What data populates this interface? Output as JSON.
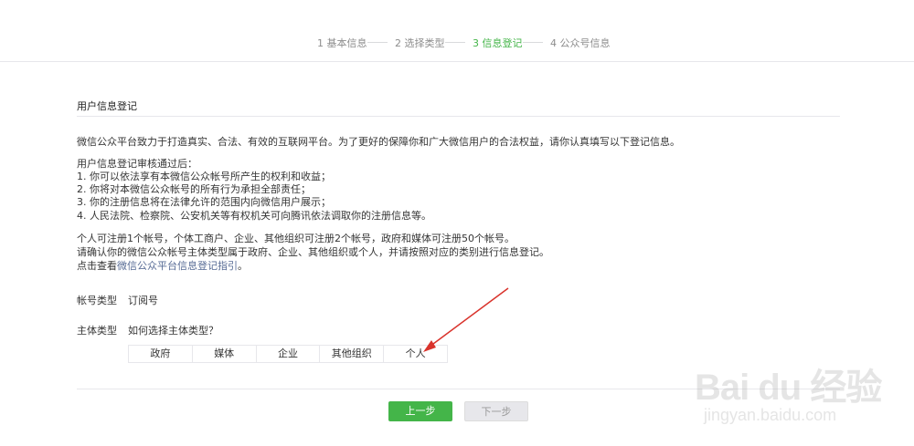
{
  "stepper": {
    "steps": [
      {
        "label": "1 基本信息"
      },
      {
        "label": "2 选择类型"
      },
      {
        "label": "3 信息登记"
      },
      {
        "label": "4 公众号信息"
      }
    ]
  },
  "section": {
    "title": "用户信息登记"
  },
  "intro": "微信公众平台致力于打造真实、合法、有效的互联网平台。为了更好的保障你和广大微信用户的合法权益，请你认真填写以下登记信息。",
  "after_review": {
    "heading": "用户信息登记审核通过后：",
    "items": [
      "1. 你可以依法享有本微信公众帐号所产生的权利和收益；",
      "2. 你将对本微信公众帐号的所有行为承担全部责任；",
      "3. 你的注册信息将在法律允许的范围内向微信用户展示；",
      "4. 人民法院、检察院、公安机关等有权机关可向腾讯依法调取你的注册信息等。"
    ]
  },
  "notes": {
    "line1": "个人可注册1个帐号，个体工商户、企业、其他组织可注册2个帐号，政府和媒体可注册50个帐号。",
    "line2": "请确认你的微信公众帐号主体类型属于政府、企业、其他组织或个人，并请按照对应的类别进行信息登记。",
    "line3_prefix": "点击查看",
    "line3_link": "微信公众平台信息登记指引",
    "line3_suffix": "。"
  },
  "account_type": {
    "label": "帐号类型",
    "value": "订阅号"
  },
  "entity_type": {
    "label": "主体类型",
    "help_link": "如何选择主体类型？",
    "options": [
      "政府",
      "媒体",
      "企业",
      "其他组织",
      "个人"
    ]
  },
  "buttons": {
    "prev": "上一步",
    "next": "下一步"
  },
  "watermark": {
    "brand": "Bai du 经验",
    "url": "jingyan.baidu.com"
  },
  "colors": {
    "accent": "#44b549",
    "link": "#576b95",
    "annotation": "#d9332c"
  }
}
